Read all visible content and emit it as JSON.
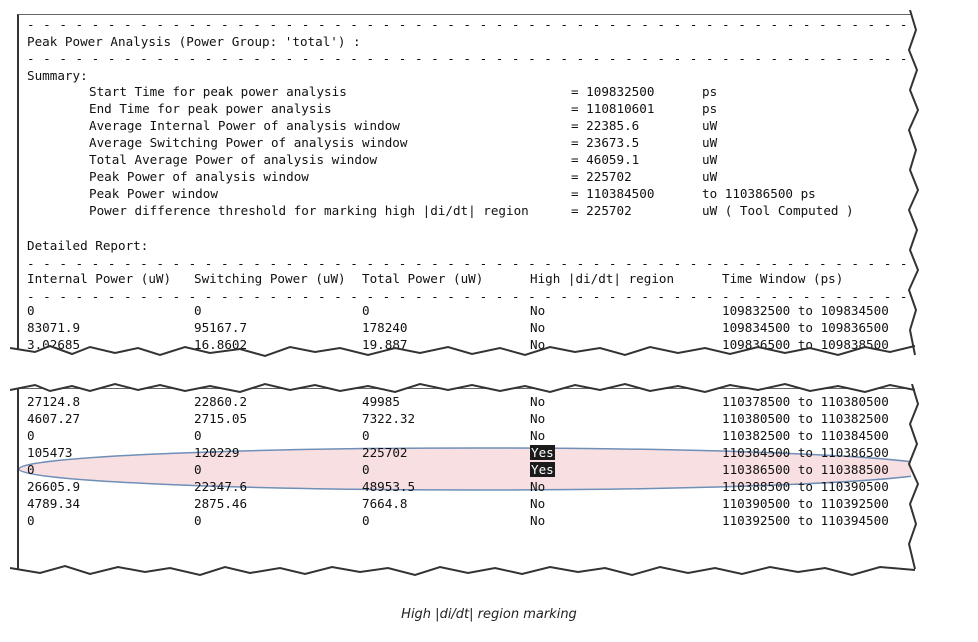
{
  "separator": "----------------------------------------------------------------------------------------------",
  "dotted": "- - - - - - - - - - - - - - - - - - - - - - - - - - - - - - - - - - - - - - - - - - - - - - - - - - - - - - -",
  "title": "Peak Power Analysis (Power Group: 'total') :",
  "summary_label": "Summary:",
  "summary": [
    {
      "label": "Start Time for peak power analysis",
      "value": "= 109832500",
      "unit": "ps"
    },
    {
      "label": "End Time for peak power analysis",
      "value": "= 110810601",
      "unit": "ps"
    },
    {
      "label": "Average Internal Power of analysis window",
      "value": "= 22385.6",
      "unit": "uW"
    },
    {
      "label": "Average Switching Power of analysis window",
      "value": "= 23673.5",
      "unit": "uW"
    },
    {
      "label": "Total Average Power of analysis window",
      "value": "= 46059.1",
      "unit": "uW"
    },
    {
      "label": "Peak Power of analysis window",
      "value": "= 225702",
      "unit": "uW"
    },
    {
      "label": "Peak Power window",
      "value": "= 110384500",
      "unit": "to 110386500 ps"
    },
    {
      "label": "Power difference threshold for marking high |di/dt| region",
      "value": "= 225702",
      "unit": "uW ( Tool Computed )"
    }
  ],
  "detailed_label": "Detailed Report:",
  "columns": [
    "Internal Power (uW)",
    "Switching Power (uW)",
    "Total Power (uW)",
    "High |di/dt| region",
    "Time Window (ps)"
  ],
  "rows_top": [
    [
      "0",
      "0",
      "0",
      "No",
      "109832500 to 109834500"
    ],
    [
      "83071.9",
      "95167.7",
      "178240",
      "No",
      "109834500 to 109836500"
    ],
    [
      "3.02685",
      "16.8602",
      "19.887",
      "No",
      "109836500 to 109838500"
    ]
  ],
  "rows_bottom": [
    [
      "27124.8",
      "22860.2",
      "49985",
      "No",
      "110378500 to 110380500"
    ],
    [
      "4607.27",
      "2715.05",
      "7322.32",
      "No",
      "110380500 to 110382500"
    ],
    [
      "0",
      "0",
      "0",
      "No",
      "110382500 to 110384500"
    ],
    [
      "105473",
      "120229",
      "225702",
      "Yes",
      "110384500 to 110386500"
    ],
    [
      "0",
      "0",
      "0",
      "Yes",
      "110386500 to 110388500"
    ],
    [
      "26605.9",
      "22347.6",
      "48953.5",
      "No",
      "110388500 to 110390500"
    ],
    [
      "4789.34",
      "2875.46",
      "7664.8",
      "No",
      "110390500 to 110392500"
    ],
    [
      "0",
      "0",
      "0",
      "No",
      "110392500 to 110394500"
    ]
  ],
  "caption": "High |di/dt| region marking",
  "colors": {
    "highlight_fill": "#f6d6d8",
    "highlight_stroke": "#6f8fb8",
    "yes_bg": "#1b1b1b"
  }
}
